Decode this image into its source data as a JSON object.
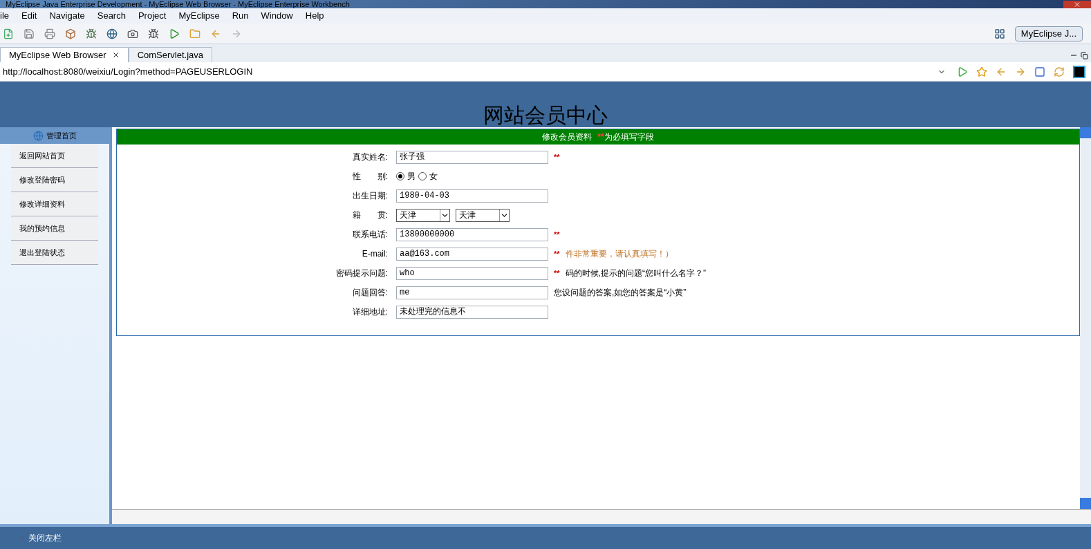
{
  "window": {
    "title": "MyEclipse Java Enterprise Development - MyEclipse Web Browser - MyEclipse Enterprise Workbench"
  },
  "menu": [
    "ile",
    "Edit",
    "Navigate",
    "Search",
    "Project",
    "MyEclipse",
    "Run",
    "Window",
    "Help"
  ],
  "perspective": {
    "label": "MyEclipse J..."
  },
  "tabs": [
    {
      "label": "MyEclipse Web Browser",
      "selected": true,
      "closable": true
    },
    {
      "label": "ComServlet.java",
      "selected": false,
      "closable": false
    }
  ],
  "address": {
    "value": "http://localhost:8080/weixiu/Login?method=PAGEUSERLOGIN"
  },
  "page": {
    "heading": "网站会员中心",
    "sidebar": {
      "title": "管理首页",
      "items": [
        "返回网站首页",
        "修改登陆密码",
        "修改详细资料",
        "我的预约信息",
        "退出登陆状态"
      ]
    },
    "form": {
      "title": "修改会员资料",
      "required_mark": "**",
      "title_suffix": "为必填写字段",
      "fields": [
        {
          "kind": "text",
          "label": "真实姓名:",
          "value": "张子强",
          "required": true
        },
        {
          "kind": "radio",
          "label": "性　　别:",
          "options": [
            {
              "label": "男",
              "selected": true
            },
            {
              "label": "女",
              "selected": false
            }
          ]
        },
        {
          "kind": "text",
          "label": "出生日期:",
          "value": "1980-04-03"
        },
        {
          "kind": "select",
          "label": "籍　　贯:",
          "values": [
            "天津",
            "天津"
          ]
        },
        {
          "kind": "text",
          "label": "联系电话:",
          "value": "13800000000",
          "required": true
        },
        {
          "kind": "text",
          "label": "E-mail:",
          "value": "aa@163.com",
          "required": true,
          "hint": "件非常重要，请认真填写！）",
          "hint_warning": true
        },
        {
          "kind": "text",
          "label": "密码提示问题:",
          "value": "who",
          "required": true,
          "hint": "码的时候,提示的问题“您叫什么名字？”",
          "hint_warning": false
        },
        {
          "kind": "text",
          "label": "问题回答:",
          "value": "me",
          "hint": "您设问题的答案,如您的答案是“小黄”",
          "hint_warning": false
        },
        {
          "kind": "text",
          "label": "详细地址:",
          "value": "未处理完的信息不"
        }
      ]
    }
  },
  "footer": {
    "label": "关闭左栏"
  }
}
